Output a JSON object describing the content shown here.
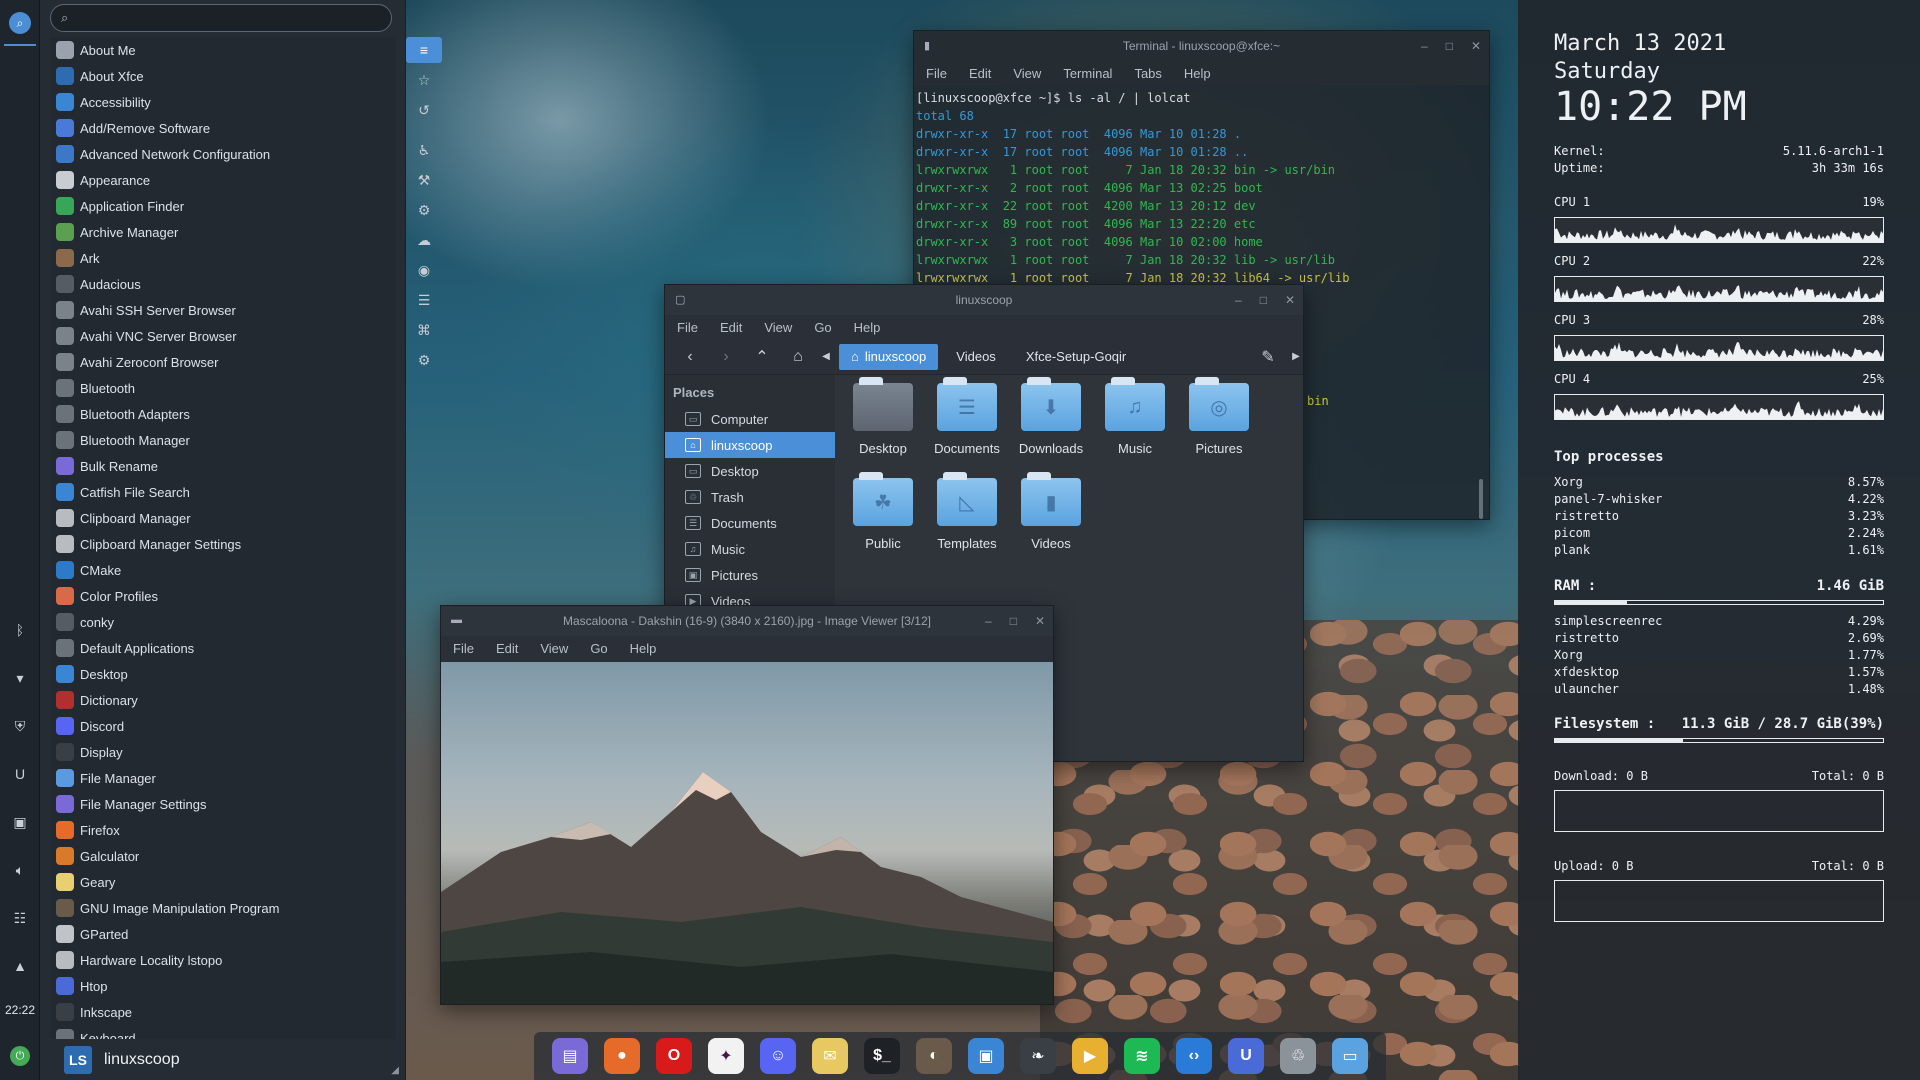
{
  "left_panel": {
    "clock": "22:22"
  },
  "menu": {
    "search_placeholder": "",
    "apps": [
      {
        "label": "About Me",
        "icon": "user-icon",
        "color": "#9aa3ad"
      },
      {
        "label": "About Xfce",
        "icon": "xfce-icon",
        "color": "#2d6cb0"
      },
      {
        "label": "Accessibility",
        "icon": "accessibility-icon",
        "color": "#3a86d4"
      },
      {
        "label": "Add/Remove Software",
        "icon": "package-icon",
        "color": "#4a7ad8"
      },
      {
        "label": "Advanced Network Configuration",
        "icon": "network-icon",
        "color": "#3d78c8"
      },
      {
        "label": "Appearance",
        "icon": "appearance-icon",
        "color": "#c9ccd0"
      },
      {
        "label": "Application Finder",
        "icon": "finder-icon",
        "color": "#37a658"
      },
      {
        "label": "Archive Manager",
        "icon": "archive-icon",
        "color": "#5aa050"
      },
      {
        "label": "Ark",
        "icon": "ark-icon",
        "color": "#8a6a4a"
      },
      {
        "label": "Audacious",
        "icon": "audacious-icon",
        "color": "#555c64"
      },
      {
        "label": "Avahi SSH Server Browser",
        "icon": "avahi-icon",
        "color": "#7a828a"
      },
      {
        "label": "Avahi VNC Server Browser",
        "icon": "avahi-icon",
        "color": "#7a828a"
      },
      {
        "label": "Avahi Zeroconf Browser",
        "icon": "avahi-icon",
        "color": "#7a828a"
      },
      {
        "label": "Bluetooth",
        "icon": "bluetooth-icon",
        "color": "#6a727a"
      },
      {
        "label": "Bluetooth Adapters",
        "icon": "bluetooth-icon",
        "color": "#6a727a"
      },
      {
        "label": "Bluetooth Manager",
        "icon": "bluetooth-icon",
        "color": "#6a727a"
      },
      {
        "label": "Bulk Rename",
        "icon": "folder-icon",
        "color": "#7a6ad8"
      },
      {
        "label": "Catfish File Search",
        "icon": "catfish-icon",
        "color": "#3a86d4"
      },
      {
        "label": "Clipboard Manager",
        "icon": "clipboard-icon",
        "color": "#b8bcc0"
      },
      {
        "label": "Clipboard Manager Settings",
        "icon": "clipboard-icon",
        "color": "#b8bcc0"
      },
      {
        "label": "CMake",
        "icon": "cmake-icon",
        "color": "#2d7ac8"
      },
      {
        "label": "Color Profiles",
        "icon": "color-icon",
        "color": "#d86a4a"
      },
      {
        "label": "conky",
        "icon": "conky-icon",
        "color": "#555c64"
      },
      {
        "label": "Default Applications",
        "icon": "default-apps-icon",
        "color": "#6a727a"
      },
      {
        "label": "Desktop",
        "icon": "desktop-icon",
        "color": "#3a86d4"
      },
      {
        "label": "Dictionary",
        "icon": "dictionary-icon",
        "color": "#b03030"
      },
      {
        "label": "Discord",
        "icon": "discord-icon",
        "color": "#5865f2"
      },
      {
        "label": "Display",
        "icon": "display-icon",
        "color": "#3a3f45"
      },
      {
        "label": "File Manager",
        "icon": "folder-icon",
        "color": "#5a9ae0"
      },
      {
        "label": "File Manager Settings",
        "icon": "folder-icon",
        "color": "#7a6ad8"
      },
      {
        "label": "Firefox",
        "icon": "firefox-icon",
        "color": "#e66a2a"
      },
      {
        "label": "Galculator",
        "icon": "calculator-icon",
        "color": "#d87a2a"
      },
      {
        "label": "Geary",
        "icon": "mail-icon",
        "color": "#e8d070"
      },
      {
        "label": "GNU Image Manipulation Program",
        "icon": "gimp-icon",
        "color": "#6a5a4a"
      },
      {
        "label": "GParted",
        "icon": "gparted-icon",
        "color": "#c0c4c8"
      },
      {
        "label": "Hardware Locality lstopo",
        "icon": "hwloc-icon",
        "color": "#b8bcc0"
      },
      {
        "label": "Htop",
        "icon": "htop-icon",
        "color": "#4a6ad8"
      },
      {
        "label": "Inkscape",
        "icon": "inkscape-icon",
        "color": "#3a3f45"
      },
      {
        "label": "Keyboard",
        "icon": "keyboard-icon",
        "color": "#6a727a"
      }
    ],
    "user": {
      "avatar_letter": "LS",
      "name": "linuxscoop"
    }
  },
  "terminal": {
    "title": "Terminal - linuxscoop@xfce:~",
    "menus": [
      "File",
      "Edit",
      "View",
      "Terminal",
      "Tabs",
      "Help"
    ],
    "prompt": "[linuxscoop@xfce ~]$ ls -al / | lolcat",
    "lines": [
      "total 68",
      "drwxr-xr-x  17 root root  4096 Mar 10 01:28 .",
      "drwxr-xr-x  17 root root  4096 Mar 10 01:28 ..",
      "lrwxrwxrwx   1 root root     7 Jan 18 20:32 bin -> usr/bin",
      "drwxr-xr-x   2 root root  4096 Mar 13 02:25 boot",
      "drwxr-xr-x  22 root root  4200 Mar 13 20:12 dev",
      "drwxr-xr-x  89 root root  4096 Mar 13 22:20 etc",
      "drwxr-xr-x   3 root root  4096 Mar 10 02:00 home",
      "lrwxrwxrwx   1 root root     7 Jan 18 20:32 lib -> usr/lib",
      "lrwxrwxrwx   1 root root     7 Jan 18 20:32 lib64 -> usr/lib"
    ],
    "partial_visible": "bin"
  },
  "file_manager": {
    "title": "linuxscoop",
    "menus": [
      "File",
      "Edit",
      "View",
      "Go",
      "Help"
    ],
    "crumbs": [
      "linuxscoop",
      "Videos",
      "Xfce-Setup-Goqir"
    ],
    "places_title": "Places",
    "places": [
      "Computer",
      "linuxscoop",
      "Desktop",
      "Trash",
      "Documents",
      "Music",
      "Pictures",
      "Videos"
    ],
    "folders": [
      "Desktop",
      "Documents",
      "Downloads",
      "Music",
      "Pictures",
      "Public",
      "Templates",
      "Videos"
    ]
  },
  "image_viewer": {
    "title": "Mascaloona - Dakshin (16-9) (3840 x 2160).jpg - Image Viewer [3/12]",
    "menus": [
      "File",
      "Edit",
      "View",
      "Go",
      "Help"
    ]
  },
  "conky": {
    "date": "March 13 2021",
    "day": "Saturday",
    "time": "10:22 PM",
    "kernel_label": "Kernel:",
    "kernel_value": "5.11.6-arch1-1",
    "uptime_label": "Uptime:",
    "uptime_value": "3h 33m 16s",
    "cpus": [
      {
        "label": "CPU 1",
        "value": "19%"
      },
      {
        "label": "CPU 2",
        "value": "22%"
      },
      {
        "label": "CPU 3",
        "value": "28%"
      },
      {
        "label": "CPU 4",
        "value": "25%"
      }
    ],
    "top_title": "Top processes",
    "top": [
      {
        "name": "Xorg",
        "value": "8.57%"
      },
      {
        "name": "panel-7-whisker",
        "value": "4.22%"
      },
      {
        "name": "ristretto",
        "value": "3.23%"
      },
      {
        "name": "picom",
        "value": "2.24%"
      },
      {
        "name": "plank",
        "value": "1.61%"
      }
    ],
    "ram_label": "RAM :",
    "ram_value": "1.46 GiB",
    "ram_fraction": 0.22,
    "ram_procs": [
      {
        "name": "simplescreenrec",
        "value": "4.29%"
      },
      {
        "name": "ristretto",
        "value": "2.69%"
      },
      {
        "name": "Xorg",
        "value": "1.77%"
      },
      {
        "name": "xfdesktop",
        "value": "1.57%"
      },
      {
        "name": "ulauncher",
        "value": "1.48%"
      }
    ],
    "fs_label": "Filesystem :",
    "fs_value": "11.3 GiB / 28.7 GiB(39%)",
    "fs_fraction": 0.39,
    "download_label": "Download: 0 B",
    "download_total": "Total: 0 B",
    "upload_label": "Upload: 0 B",
    "upload_total": "Total: 0 B"
  },
  "dock": {
    "items": [
      {
        "name": "file-manager-icon",
        "color": "#7a6ad8"
      },
      {
        "name": "firefox-icon",
        "color": "#e66a2a"
      },
      {
        "name": "opera-icon",
        "color": "#d81a1a"
      },
      {
        "name": "slack-icon",
        "color": "#f2f2f2"
      },
      {
        "name": "discord-icon",
        "color": "#5865f2"
      },
      {
        "name": "notes-icon",
        "color": "#e8c860"
      },
      {
        "name": "terminal-icon",
        "color": "#1e2226"
      },
      {
        "name": "gimp-icon",
        "color": "#6a5a4a"
      },
      {
        "name": "image-viewer-icon",
        "color": "#3a86d4"
      },
      {
        "name": "inkscape-icon",
        "color": "#3a3f45"
      },
      {
        "name": "media-player-icon",
        "color": "#e8b030"
      },
      {
        "name": "spotify-icon",
        "color": "#1db954"
      },
      {
        "name": "vscode-icon",
        "color": "#2a7ad8"
      },
      {
        "name": "ulauncher-icon",
        "color": "#4a6ad8"
      },
      {
        "name": "trash-icon",
        "color": "#8a929a"
      },
      {
        "name": "show-desktop-icon",
        "color": "#5aa3e0"
      }
    ]
  }
}
